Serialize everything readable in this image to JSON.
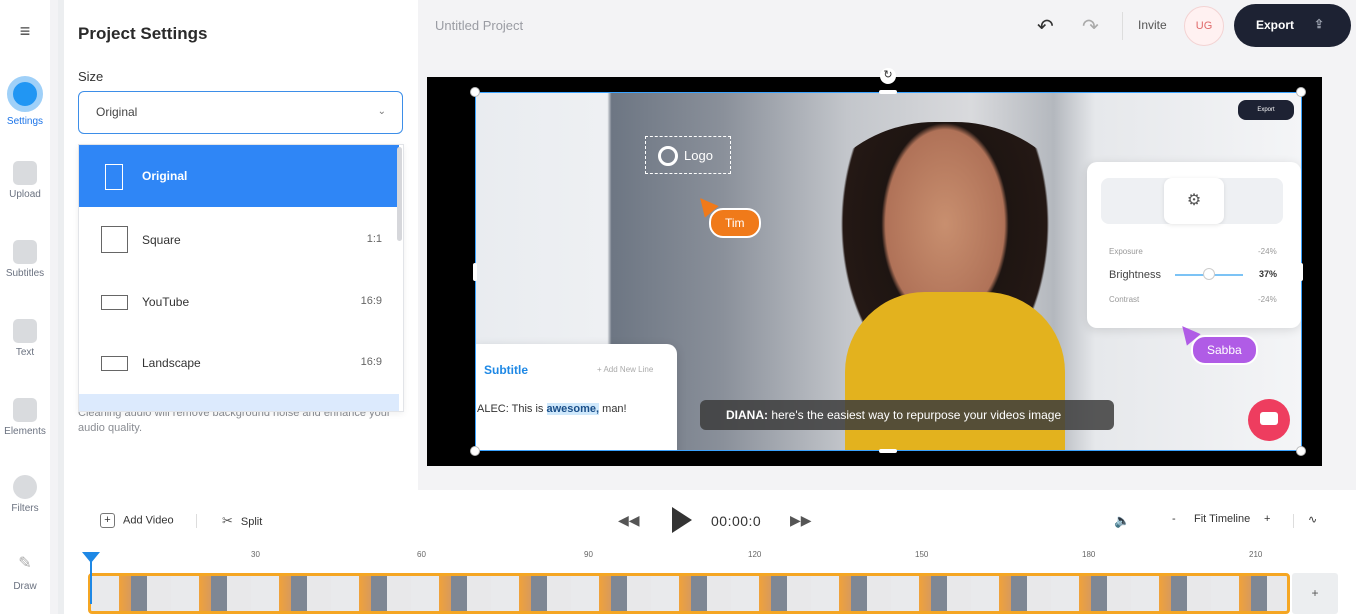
{
  "rail": {
    "menu_icon": "hamburger-icon",
    "items": [
      {
        "label": "Settings",
        "icon": "settings-icon"
      },
      {
        "label": "Upload",
        "icon": "image-icon"
      },
      {
        "label": "Subtitles",
        "icon": "subtitles-icon"
      },
      {
        "label": "Text",
        "icon": "text-icon"
      },
      {
        "label": "Elements",
        "icon": "elements-icon"
      },
      {
        "label": "Filters",
        "icon": "filters-icon"
      },
      {
        "label": "Draw",
        "icon": "pencil-icon"
      }
    ]
  },
  "panel": {
    "title": "Project Settings",
    "size_label": "Size",
    "size_value": "Original",
    "hint": "Cleaning audio will remove background noise and enhance your audio quality.",
    "options": [
      {
        "name": "Original",
        "ratio": ""
      },
      {
        "name": "Square",
        "ratio": "1:1"
      },
      {
        "name": "YouTube",
        "ratio": "16:9"
      },
      {
        "name": "Landscape",
        "ratio": "16:9"
      }
    ]
  },
  "topbar": {
    "project_title": "Untitled Project",
    "invite": "Invite",
    "avatar": "UG",
    "export": "Export"
  },
  "video": {
    "logo": "Logo",
    "tag_tim": "Tim",
    "tag_sabba": "Sabba",
    "subtitle_title": "Subtitle",
    "add_line": "+ Add New Line",
    "subtitle_line_pre": "ALEC: This is ",
    "subtitle_line_hl": "awesome,",
    "subtitle_line_post": " man!",
    "caption_speaker": "DIANA:",
    "caption_text": " here's the easiest way to repurpose your videos image",
    "adjust": {
      "exposure": "Exposure",
      "exposure_val": "-24%",
      "brightness": "Brightness",
      "brightness_val": "37%",
      "contrast": "Contrast",
      "contrast_val": "-24%"
    },
    "mini_export": "Export"
  },
  "timeline": {
    "add_video": "Add Video",
    "split": "Split",
    "time": "00:00:0",
    "zoom_minus": "-",
    "fit": "Fit Timeline",
    "zoom_plus": "+",
    "add_clip": "+",
    "ticks": [
      "30",
      "60",
      "90",
      "120",
      "150",
      "180",
      "210"
    ]
  }
}
